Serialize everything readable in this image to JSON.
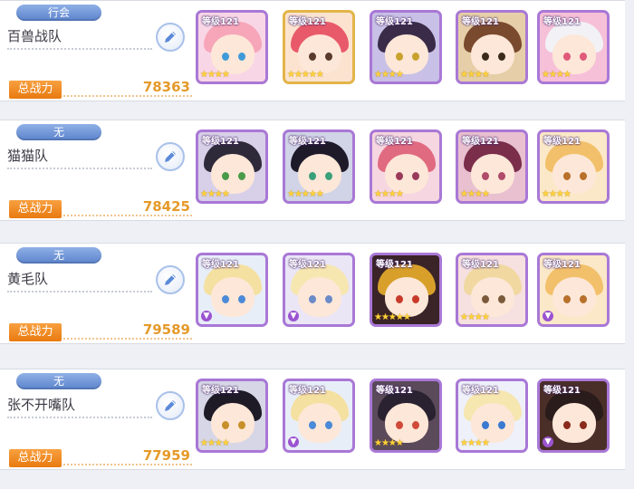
{
  "level_prefix": "等级",
  "power_label": "总战力",
  "teams": [
    {
      "tag": "行会",
      "name": "百兽战队",
      "power": "78363",
      "characters": [
        {
          "level": "121",
          "stars": "★★★★",
          "hair": "#f6a6b8",
          "bg": "#f8d6e6",
          "eye": "#3f9bd8",
          "frame": "purple",
          "ue": false
        },
        {
          "level": "121",
          "stars": "★★★★★",
          "hair": "#e85a6a",
          "bg": "#fbe3d0",
          "eye": "#5a3a2a",
          "frame": "gold",
          "ue": false
        },
        {
          "level": "121",
          "stars": "★★★★",
          "hair": "#3a2c48",
          "bg": "#c8c0e6",
          "eye": "#c9a22e",
          "frame": "purple",
          "ue": false
        },
        {
          "level": "121",
          "stars": "★★★★",
          "hair": "#7a4a2e",
          "bg": "#e6cfa8",
          "eye": "#3a2a1a",
          "frame": "purple",
          "ue": false
        },
        {
          "level": "121",
          "stars": "★★★★",
          "hair": "#f2f2f6",
          "bg": "#f6c0d8",
          "eye": "#e05a7a",
          "frame": "purple",
          "ue": false
        }
      ]
    },
    {
      "tag": "无",
      "name": "猫猫队",
      "power": "78425",
      "characters": [
        {
          "level": "121",
          "stars": "★★★★",
          "hair": "#2e2a3a",
          "bg": "#d8d0e8",
          "eye": "#4a9a4a",
          "frame": "purple",
          "ue": false
        },
        {
          "level": "121",
          "stars": "★★★★★",
          "hair": "#1e1a2a",
          "bg": "#d0d4e6",
          "eye": "#3aa07a",
          "frame": "purple",
          "ue": false
        },
        {
          "level": "121",
          "stars": "★★★★",
          "hair": "#e06a80",
          "bg": "#f6d6e0",
          "eye": "#9a3a5a",
          "frame": "purple",
          "ue": false
        },
        {
          "level": "121",
          "stars": "★★★★",
          "hair": "#7a2e4a",
          "bg": "#e8c0d0",
          "eye": "#b04a6a",
          "frame": "purple",
          "ue": false
        },
        {
          "level": "121",
          "stars": "★★★★",
          "hair": "#f2c06a",
          "bg": "#fbe8c8",
          "eye": "#b8702a",
          "frame": "purple",
          "ue": false
        }
      ]
    },
    {
      "tag": "无",
      "name": "黄毛队",
      "power": "79589",
      "characters": [
        {
          "level": "121",
          "stars": "",
          "hair": "#f4e0a0",
          "bg": "#e8eef8",
          "eye": "#4a8ad8",
          "frame": "purple",
          "ue": true
        },
        {
          "level": "121",
          "stars": "",
          "hair": "#f6e6b0",
          "bg": "#eae6f6",
          "eye": "#6a8ac8",
          "frame": "purple",
          "ue": true
        },
        {
          "level": "121",
          "stars": "★★★★★",
          "hair": "#d8a02a",
          "bg": "#3a2428",
          "eye": "#c83a2a",
          "frame": "purple",
          "ue": false
        },
        {
          "level": "121",
          "stars": "★★★★",
          "hair": "#f0d8a0",
          "bg": "#f6e0e0",
          "eye": "#7a5a3a",
          "frame": "purple",
          "ue": false
        },
        {
          "level": "121",
          "stars": "",
          "hair": "#f2c06a",
          "bg": "#fbe8c8",
          "eye": "#b8702a",
          "frame": "purple",
          "ue": true
        }
      ]
    },
    {
      "tag": "无",
      "name": "张不开嘴队",
      "power": "77959",
      "characters": [
        {
          "level": "121",
          "stars": "★★★★",
          "hair": "#1e1a26",
          "bg": "#d6d6e6",
          "eye": "#c8902a",
          "frame": "purple",
          "ue": false
        },
        {
          "level": "121",
          "stars": "",
          "hair": "#f4e0a0",
          "bg": "#e8eef8",
          "eye": "#4a8ad8",
          "frame": "purple",
          "ue": true
        },
        {
          "level": "121",
          "stars": "★★★★",
          "hair": "#2a2230",
          "bg": "#5a4a5a",
          "eye": "#d04a3a",
          "frame": "purple",
          "ue": false
        },
        {
          "level": "121",
          "stars": "★★★★",
          "hair": "#f6e6b0",
          "bg": "#eef0fa",
          "eye": "#3a7ad0",
          "frame": "purple",
          "ue": false
        },
        {
          "level": "121",
          "stars": "",
          "hair": "#2a1c1a",
          "bg": "#4a2e28",
          "eye": "#8a2a1a",
          "frame": "purple",
          "ue": true
        }
      ]
    }
  ]
}
